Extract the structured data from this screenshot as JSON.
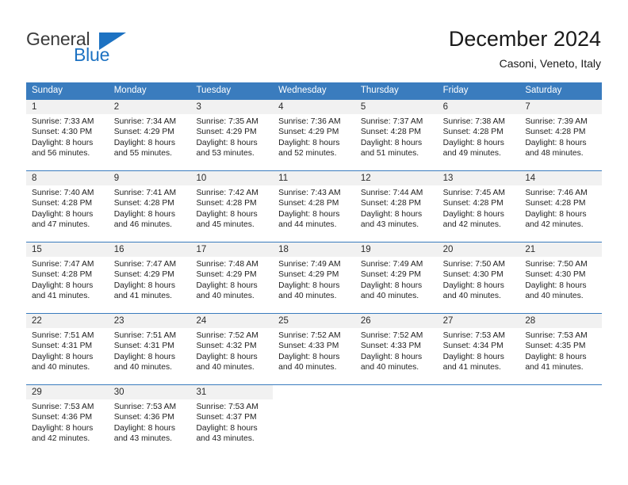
{
  "brand": {
    "name_top": "General",
    "name_bottom": "Blue",
    "triangle_icon": "triangle-icon",
    "color_dark": "#3b3b3b",
    "color_blue": "#1d72c2"
  },
  "header": {
    "month_title": "December 2024",
    "location": "Casoni, Veneto, Italy"
  },
  "colors": {
    "header_blue": "#3a7cbe",
    "day_number_bg": "#f1f1f1",
    "cell_bg": "#ffffff",
    "text": "#1f1f1f"
  },
  "weekdays": [
    "Sunday",
    "Monday",
    "Tuesday",
    "Wednesday",
    "Thursday",
    "Friday",
    "Saturday"
  ],
  "weeks": [
    [
      {
        "day": "1",
        "sunrise": "Sunrise: 7:33 AM",
        "sunset": "Sunset: 4:30 PM",
        "daylight1": "Daylight: 8 hours",
        "daylight2": "and 56 minutes."
      },
      {
        "day": "2",
        "sunrise": "Sunrise: 7:34 AM",
        "sunset": "Sunset: 4:29 PM",
        "daylight1": "Daylight: 8 hours",
        "daylight2": "and 55 minutes."
      },
      {
        "day": "3",
        "sunrise": "Sunrise: 7:35 AM",
        "sunset": "Sunset: 4:29 PM",
        "daylight1": "Daylight: 8 hours",
        "daylight2": "and 53 minutes."
      },
      {
        "day": "4",
        "sunrise": "Sunrise: 7:36 AM",
        "sunset": "Sunset: 4:29 PM",
        "daylight1": "Daylight: 8 hours",
        "daylight2": "and 52 minutes."
      },
      {
        "day": "5",
        "sunrise": "Sunrise: 7:37 AM",
        "sunset": "Sunset: 4:28 PM",
        "daylight1": "Daylight: 8 hours",
        "daylight2": "and 51 minutes."
      },
      {
        "day": "6",
        "sunrise": "Sunrise: 7:38 AM",
        "sunset": "Sunset: 4:28 PM",
        "daylight1": "Daylight: 8 hours",
        "daylight2": "and 49 minutes."
      },
      {
        "day": "7",
        "sunrise": "Sunrise: 7:39 AM",
        "sunset": "Sunset: 4:28 PM",
        "daylight1": "Daylight: 8 hours",
        "daylight2": "and 48 minutes."
      }
    ],
    [
      {
        "day": "8",
        "sunrise": "Sunrise: 7:40 AM",
        "sunset": "Sunset: 4:28 PM",
        "daylight1": "Daylight: 8 hours",
        "daylight2": "and 47 minutes."
      },
      {
        "day": "9",
        "sunrise": "Sunrise: 7:41 AM",
        "sunset": "Sunset: 4:28 PM",
        "daylight1": "Daylight: 8 hours",
        "daylight2": "and 46 minutes."
      },
      {
        "day": "10",
        "sunrise": "Sunrise: 7:42 AM",
        "sunset": "Sunset: 4:28 PM",
        "daylight1": "Daylight: 8 hours",
        "daylight2": "and 45 minutes."
      },
      {
        "day": "11",
        "sunrise": "Sunrise: 7:43 AM",
        "sunset": "Sunset: 4:28 PM",
        "daylight1": "Daylight: 8 hours",
        "daylight2": "and 44 minutes."
      },
      {
        "day": "12",
        "sunrise": "Sunrise: 7:44 AM",
        "sunset": "Sunset: 4:28 PM",
        "daylight1": "Daylight: 8 hours",
        "daylight2": "and 43 minutes."
      },
      {
        "day": "13",
        "sunrise": "Sunrise: 7:45 AM",
        "sunset": "Sunset: 4:28 PM",
        "daylight1": "Daylight: 8 hours",
        "daylight2": "and 42 minutes."
      },
      {
        "day": "14",
        "sunrise": "Sunrise: 7:46 AM",
        "sunset": "Sunset: 4:28 PM",
        "daylight1": "Daylight: 8 hours",
        "daylight2": "and 42 minutes."
      }
    ],
    [
      {
        "day": "15",
        "sunrise": "Sunrise: 7:47 AM",
        "sunset": "Sunset: 4:28 PM",
        "daylight1": "Daylight: 8 hours",
        "daylight2": "and 41 minutes."
      },
      {
        "day": "16",
        "sunrise": "Sunrise: 7:47 AM",
        "sunset": "Sunset: 4:29 PM",
        "daylight1": "Daylight: 8 hours",
        "daylight2": "and 41 minutes."
      },
      {
        "day": "17",
        "sunrise": "Sunrise: 7:48 AM",
        "sunset": "Sunset: 4:29 PM",
        "daylight1": "Daylight: 8 hours",
        "daylight2": "and 40 minutes."
      },
      {
        "day": "18",
        "sunrise": "Sunrise: 7:49 AM",
        "sunset": "Sunset: 4:29 PM",
        "daylight1": "Daylight: 8 hours",
        "daylight2": "and 40 minutes."
      },
      {
        "day": "19",
        "sunrise": "Sunrise: 7:49 AM",
        "sunset": "Sunset: 4:29 PM",
        "daylight1": "Daylight: 8 hours",
        "daylight2": "and 40 minutes."
      },
      {
        "day": "20",
        "sunrise": "Sunrise: 7:50 AM",
        "sunset": "Sunset: 4:30 PM",
        "daylight1": "Daylight: 8 hours",
        "daylight2": "and 40 minutes."
      },
      {
        "day": "21",
        "sunrise": "Sunrise: 7:50 AM",
        "sunset": "Sunset: 4:30 PM",
        "daylight1": "Daylight: 8 hours",
        "daylight2": "and 40 minutes."
      }
    ],
    [
      {
        "day": "22",
        "sunrise": "Sunrise: 7:51 AM",
        "sunset": "Sunset: 4:31 PM",
        "daylight1": "Daylight: 8 hours",
        "daylight2": "and 40 minutes."
      },
      {
        "day": "23",
        "sunrise": "Sunrise: 7:51 AM",
        "sunset": "Sunset: 4:31 PM",
        "daylight1": "Daylight: 8 hours",
        "daylight2": "and 40 minutes."
      },
      {
        "day": "24",
        "sunrise": "Sunrise: 7:52 AM",
        "sunset": "Sunset: 4:32 PM",
        "daylight1": "Daylight: 8 hours",
        "daylight2": "and 40 minutes."
      },
      {
        "day": "25",
        "sunrise": "Sunrise: 7:52 AM",
        "sunset": "Sunset: 4:33 PM",
        "daylight1": "Daylight: 8 hours",
        "daylight2": "and 40 minutes."
      },
      {
        "day": "26",
        "sunrise": "Sunrise: 7:52 AM",
        "sunset": "Sunset: 4:33 PM",
        "daylight1": "Daylight: 8 hours",
        "daylight2": "and 40 minutes."
      },
      {
        "day": "27",
        "sunrise": "Sunrise: 7:53 AM",
        "sunset": "Sunset: 4:34 PM",
        "daylight1": "Daylight: 8 hours",
        "daylight2": "and 41 minutes."
      },
      {
        "day": "28",
        "sunrise": "Sunrise: 7:53 AM",
        "sunset": "Sunset: 4:35 PM",
        "daylight1": "Daylight: 8 hours",
        "daylight2": "and 41 minutes."
      }
    ],
    [
      {
        "day": "29",
        "sunrise": "Sunrise: 7:53 AM",
        "sunset": "Sunset: 4:36 PM",
        "daylight1": "Daylight: 8 hours",
        "daylight2": "and 42 minutes."
      },
      {
        "day": "30",
        "sunrise": "Sunrise: 7:53 AM",
        "sunset": "Sunset: 4:36 PM",
        "daylight1": "Daylight: 8 hours",
        "daylight2": "and 43 minutes."
      },
      {
        "day": "31",
        "sunrise": "Sunrise: 7:53 AM",
        "sunset": "Sunset: 4:37 PM",
        "daylight1": "Daylight: 8 hours",
        "daylight2": "and 43 minutes."
      },
      {
        "day": "",
        "sunrise": "",
        "sunset": "",
        "daylight1": "",
        "daylight2": ""
      },
      {
        "day": "",
        "sunrise": "",
        "sunset": "",
        "daylight1": "",
        "daylight2": ""
      },
      {
        "day": "",
        "sunrise": "",
        "sunset": "",
        "daylight1": "",
        "daylight2": ""
      },
      {
        "day": "",
        "sunrise": "",
        "sunset": "",
        "daylight1": "",
        "daylight2": ""
      }
    ]
  ]
}
